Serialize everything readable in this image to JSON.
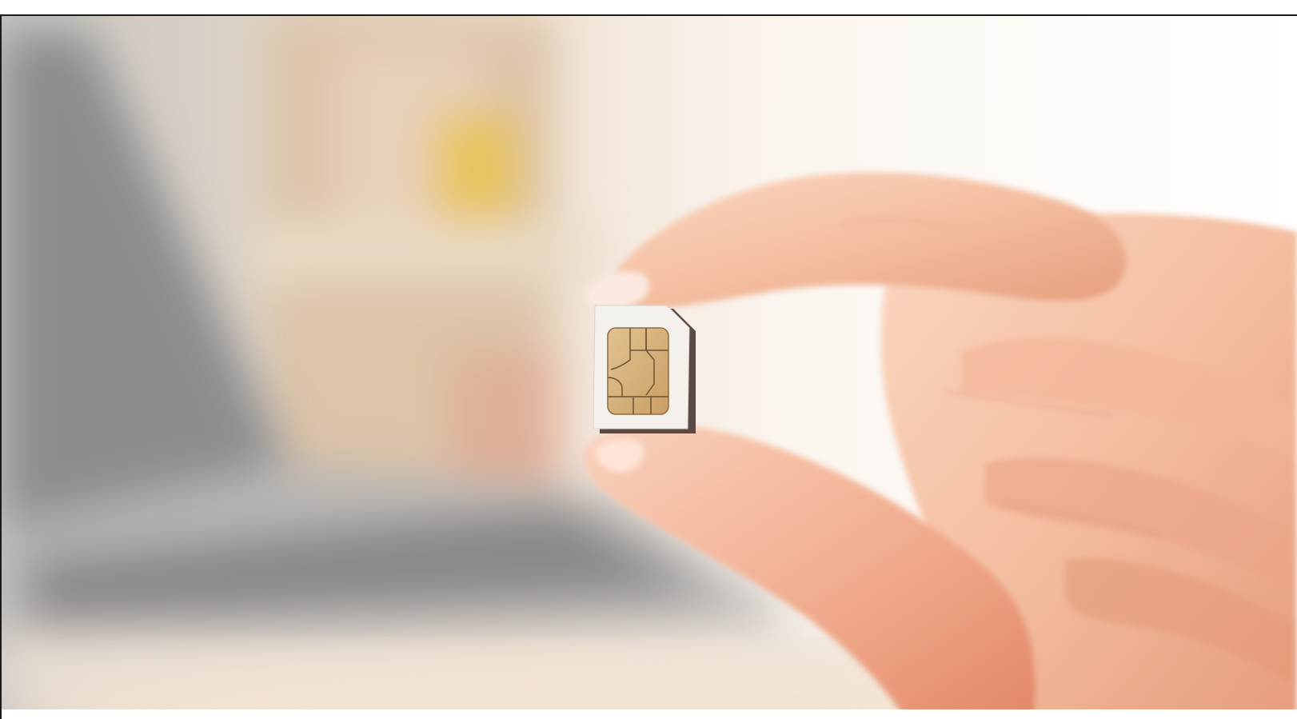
{
  "image": {
    "alt": "",
    "colors": {
      "background_warm": "#f6eee6",
      "laptop_gray": "#8d8d8f",
      "shelf_wood": "#d8c2a8",
      "yellow_accent": "#e8c24a",
      "skin_light": "#f7c9ad",
      "skin_shadow": "#e39b7a",
      "sim_white": "#f4f1ec",
      "sim_edge": "#5b4a44",
      "chip_gold": "#d9b47c"
    },
    "icons": []
  }
}
